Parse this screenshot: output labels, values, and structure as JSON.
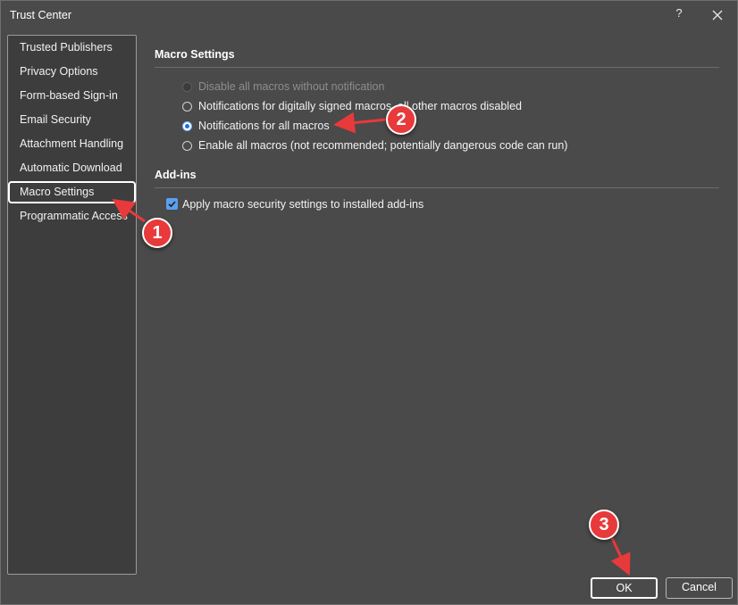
{
  "window": {
    "title": "Trust Center",
    "help_label": "?"
  },
  "sidebar": {
    "items": [
      {
        "label": "Trusted Publishers"
      },
      {
        "label": "Privacy Options"
      },
      {
        "label": "Form-based Sign-in"
      },
      {
        "label": "Email Security"
      },
      {
        "label": "Attachment Handling"
      },
      {
        "label": "Automatic Download"
      },
      {
        "label": "Macro Settings",
        "selected": true
      },
      {
        "label": "Programmatic Access"
      }
    ]
  },
  "macro_settings": {
    "heading": "Macro Settings",
    "options": [
      {
        "label": "Disable all macros without notification",
        "state": "disabled"
      },
      {
        "label": "Notifications for digitally signed macros, all other macros disabled",
        "state": "unchecked"
      },
      {
        "label": "Notifications for all macros",
        "state": "checked"
      },
      {
        "label": "Enable all macros (not recommended; potentially dangerous code can run)",
        "state": "unchecked"
      }
    ]
  },
  "addins": {
    "heading": "Add-ins",
    "checkbox_label": "Apply macro security settings to installed add-ins",
    "checked": true
  },
  "buttons": {
    "ok": "OK",
    "cancel": "Cancel"
  },
  "annotations": {
    "step1": "1",
    "step2": "2",
    "step3": "3"
  },
  "colors": {
    "background": "#4a4a4a",
    "accent": "#1e6fd9",
    "annotation": "#e8393b"
  }
}
